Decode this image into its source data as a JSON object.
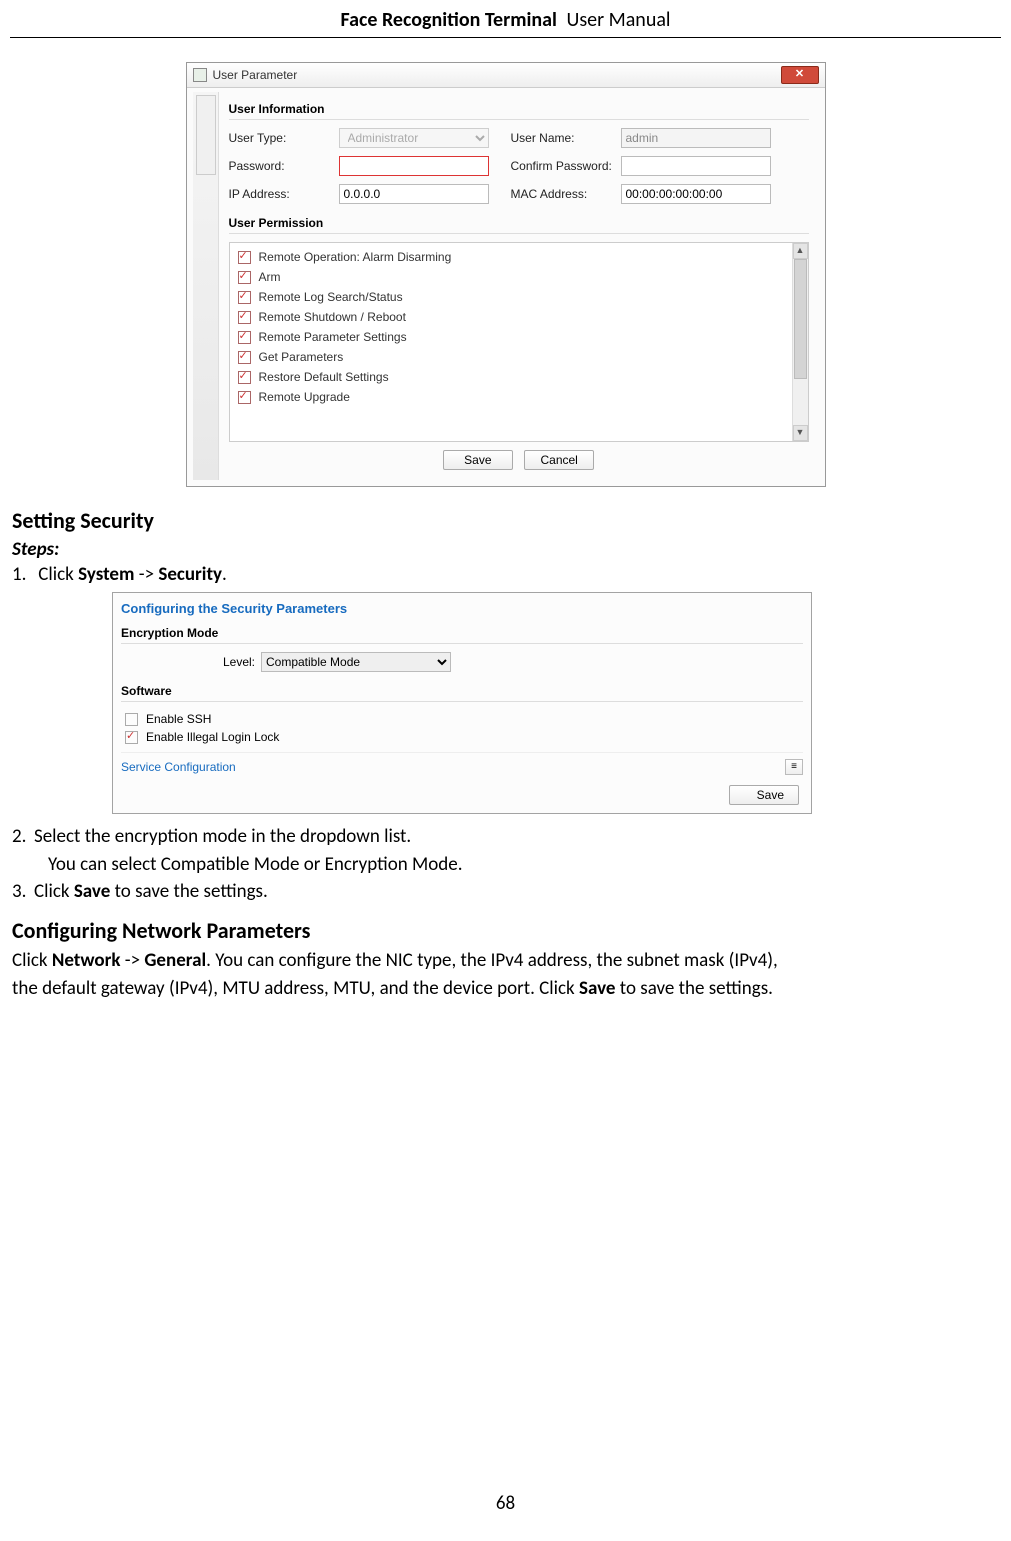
{
  "header": {
    "bold": "Face Recognition Terminal",
    "reg": "User Manual"
  },
  "dialog1": {
    "title": "User Parameter",
    "close_glyph": "✕",
    "section_info": "User Information",
    "labels": {
      "user_type": "User Type:",
      "user_name": "User Name:",
      "password": "Password:",
      "confirm_password": "Confirm Password:",
      "ip_address": "IP Address:",
      "mac_address": "MAC Address:"
    },
    "values": {
      "user_type": "Administrator",
      "user_name": "admin",
      "password": "",
      "confirm_password": "",
      "ip_address": "0.0.0.0",
      "mac_address": "00:00:00:00:00:00"
    },
    "section_perm": "User Permission",
    "permissions": [
      "Remote Operation: Alarm Disarming",
      "Arm",
      "Remote Log Search/Status",
      "Remote Shutdown / Reboot",
      "Remote Parameter Settings",
      "Get Parameters",
      "Restore Default Settings",
      "Remote Upgrade"
    ],
    "buttons": {
      "save": "Save",
      "cancel": "Cancel"
    }
  },
  "doc": {
    "h_setting_security": "Setting Security",
    "steps_label": "Steps:",
    "step1_pre": "Click ",
    "step1_b1": "System",
    "step1_mid": " -> ",
    "step1_b2": "Security",
    "step1_post": ".",
    "step2": "Select the encryption mode in the dropdown list.",
    "step2_sub": "You can select Compatible Mode or Encryption Mode.",
    "step3_pre": "Click ",
    "step3_b": "Save",
    "step3_post": " to save the settings.",
    "h_network": "Configuring Network Parameters",
    "net_pre": "Click ",
    "net_b1": "Network",
    "net_mid": " -> ",
    "net_b2": "General",
    "net_rest1": ". You can configure the NIC type, the IPv4 address, the subnet mask (IPv4),",
    "net_rest2_a": "the default gateway (IPv4), MTU address, MTU, and the device port. Click ",
    "net_rest2_b": "Save",
    "net_rest2_c": " to save the settings."
  },
  "dialog2": {
    "title": "Configuring the Security Parameters",
    "enc_head": "Encryption Mode",
    "level_label": "Level:",
    "level_value": "Compatible Mode",
    "software_head": "Software",
    "enable_ssh": "Enable SSH",
    "enable_ill": "Enable Illegal Login Lock",
    "service_conf": "Service Configuration",
    "expand_glyph": "≡",
    "save": "Save"
  },
  "footer": {
    "page_number": "68"
  }
}
